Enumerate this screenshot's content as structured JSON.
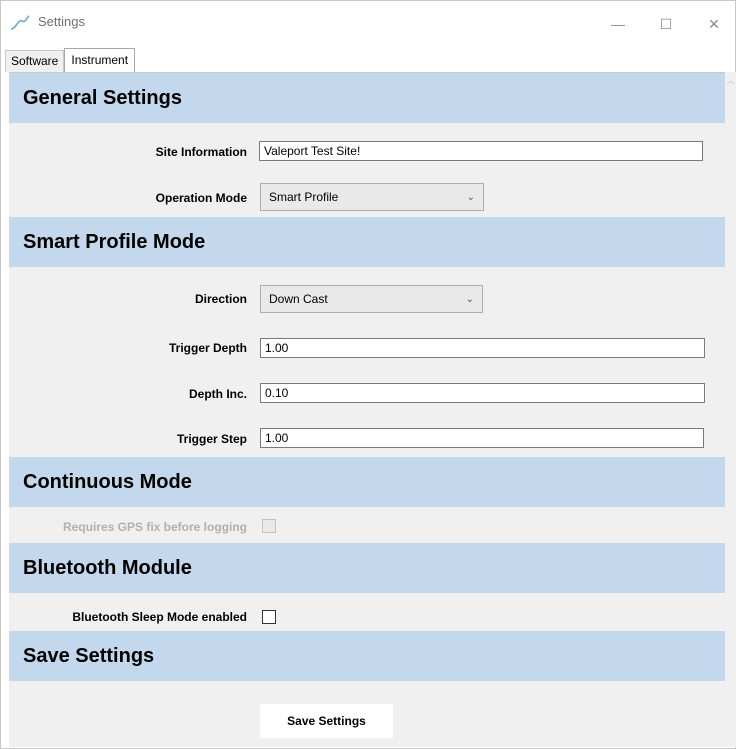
{
  "window": {
    "title": "Settings",
    "icon": "app-wave-icon",
    "controls": {
      "minimize": "—",
      "maximize": "☐",
      "close": "✕"
    }
  },
  "tabs": [
    {
      "label": "Software",
      "active": false
    },
    {
      "label": "Instrument",
      "active": true
    }
  ],
  "sections": {
    "general": {
      "header": "General Settings",
      "site_label": "Site Information",
      "site_value": "Valeport Test Site!",
      "mode_label": "Operation Mode",
      "mode_value": "Smart Profile"
    },
    "smart_profile": {
      "header": "Smart Profile Mode",
      "direction_label": "Direction",
      "direction_value": "Down Cast",
      "trigger_depth_label": "Trigger Depth",
      "trigger_depth_value": "1.00",
      "depth_inc_label": "Depth Inc.",
      "depth_inc_value": "0.10",
      "trigger_step_label": "Trigger Step",
      "trigger_step_value": "1.00"
    },
    "continuous": {
      "header": "Continuous Mode",
      "gps_label": "Requires GPS fix before logging",
      "gps_checked": false,
      "gps_enabled": false
    },
    "bluetooth": {
      "header": "Bluetooth Module",
      "sleep_label": "Bluetooth Sleep Mode enabled",
      "sleep_checked": false
    },
    "save": {
      "header": "Save Settings",
      "button_label": "Save Settings"
    }
  },
  "colors": {
    "section_header_bg": "#c3d8ec",
    "panel_bg": "#f0f0f0"
  }
}
